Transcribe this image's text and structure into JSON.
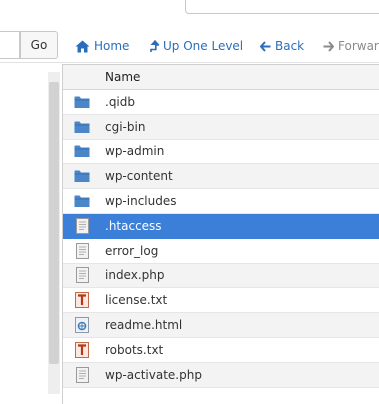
{
  "toolbar": {
    "go_label": "Go",
    "home_label": "Home",
    "up_label": "Up One Level",
    "back_label": "Back",
    "forward_label": "Forward"
  },
  "table": {
    "column_name": "Name",
    "files": [
      {
        "name": ".qidb",
        "type": "folder"
      },
      {
        "name": "cgi-bin",
        "type": "folder"
      },
      {
        "name": "wp-admin",
        "type": "folder"
      },
      {
        "name": "wp-content",
        "type": "folder"
      },
      {
        "name": "wp-includes",
        "type": "folder"
      },
      {
        "name": ".htaccess",
        "type": "text",
        "selected": true
      },
      {
        "name": "error_log",
        "type": "text"
      },
      {
        "name": "index.php",
        "type": "text"
      },
      {
        "name": "license.txt",
        "type": "plain-text"
      },
      {
        "name": "readme.html",
        "type": "html"
      },
      {
        "name": "robots.txt",
        "type": "plain-text"
      },
      {
        "name": "wp-activate.php",
        "type": "text"
      }
    ]
  },
  "colors": {
    "accent": "#2a6ebb",
    "selected_row": "#3b7fd9",
    "folder": "#4a86c8"
  }
}
